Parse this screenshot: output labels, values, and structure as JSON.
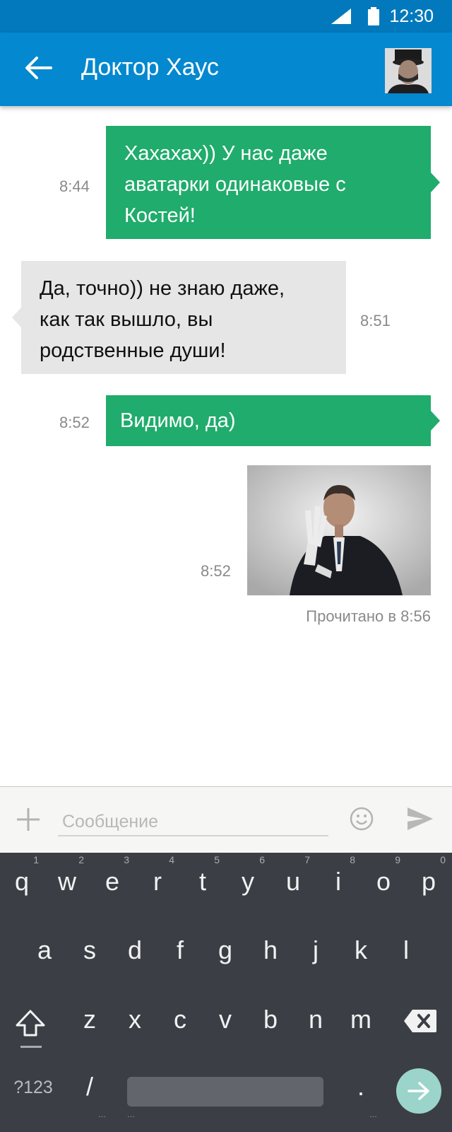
{
  "status_bar": {
    "time": "12:30"
  },
  "header": {
    "title": "Доктор Хаус"
  },
  "messages": [
    {
      "direction": "out",
      "line1": "Хахахах)) У нас даже",
      "line2": "аватарки одинаковые с",
      "line3": "Костей!",
      "time": "8:44"
    },
    {
      "direction": "in",
      "line1": "Да, точно)) не знаю даже,",
      "line2": "как так вышло, вы",
      "line3": "родственные души!",
      "time": "8:51"
    },
    {
      "direction": "out",
      "text": "Видимо, да)",
      "time": "8:52"
    },
    {
      "direction": "out",
      "type": "photo",
      "time": "8:52"
    }
  ],
  "read_receipt": "Прочитано в 8:56",
  "composer": {
    "placeholder": "Сообщение"
  },
  "keyboard": {
    "row1": [
      {
        "key": "q",
        "hint": "1"
      },
      {
        "key": "w",
        "hint": "2"
      },
      {
        "key": "e",
        "hint": "3"
      },
      {
        "key": "r",
        "hint": "4"
      },
      {
        "key": "t",
        "hint": "5"
      },
      {
        "key": "y",
        "hint": "6"
      },
      {
        "key": "u",
        "hint": "7"
      },
      {
        "key": "i",
        "hint": "8"
      },
      {
        "key": "o",
        "hint": "9"
      },
      {
        "key": "p",
        "hint": "0"
      }
    ],
    "row2": [
      "a",
      "s",
      "d",
      "f",
      "g",
      "h",
      "j",
      "k",
      "l"
    ],
    "row3": [
      "z",
      "x",
      "c",
      "v",
      "b",
      "n",
      "m"
    ],
    "symbols_label": "?123",
    "slash": "/",
    "period": ".",
    "ellipsis": "..."
  },
  "colors": {
    "status_bar": "#0379bd",
    "app_bar": "#0488cf",
    "outgoing_bubble": "#20ac6c",
    "incoming_bubble": "#e6e6e6",
    "keyboard_bg": "#3b3f45",
    "enter_key": "#9bd4cb"
  },
  "icons": [
    "signal-icon",
    "battery-icon",
    "back-arrow-icon",
    "plus-icon",
    "smile-icon",
    "send-icon",
    "shift-icon",
    "backspace-icon",
    "enter-arrow-icon"
  ]
}
